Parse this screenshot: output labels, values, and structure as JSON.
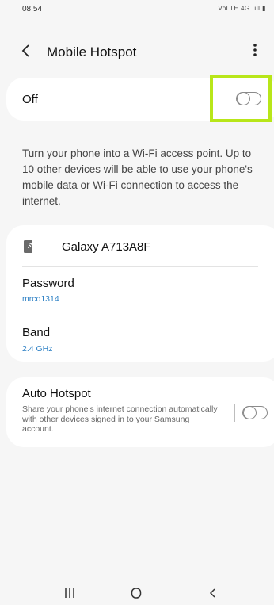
{
  "status_bar": {
    "time": "08:54",
    "icons": "VoLTE 4G .ıll ▮"
  },
  "app_bar": {
    "title": "Mobile Hotspot",
    "back_icon": "back-chevron-icon",
    "more_icon": "more-vertical-icon"
  },
  "master_switch": {
    "label": "Off",
    "state": "off"
  },
  "description": "Turn your phone into a Wi-Fi access point. Up to 10 other devices will be able to use your phone's mobile data or Wi-Fi connection to access the internet.",
  "details": {
    "device_name": "Galaxy A713A8F",
    "password_label": "Password",
    "password_value": "mrco1314",
    "band_label": "Band",
    "band_value": "2.4 GHz"
  },
  "auto_hotspot": {
    "title": "Auto Hotspot",
    "description": "Share your phone's internet connection automatically with other devices signed in to your Samsung account.",
    "state": "off"
  },
  "colors": {
    "accent_value": "#2b7fc4",
    "highlight": "#b8e619",
    "background": "#f6f6f6"
  }
}
